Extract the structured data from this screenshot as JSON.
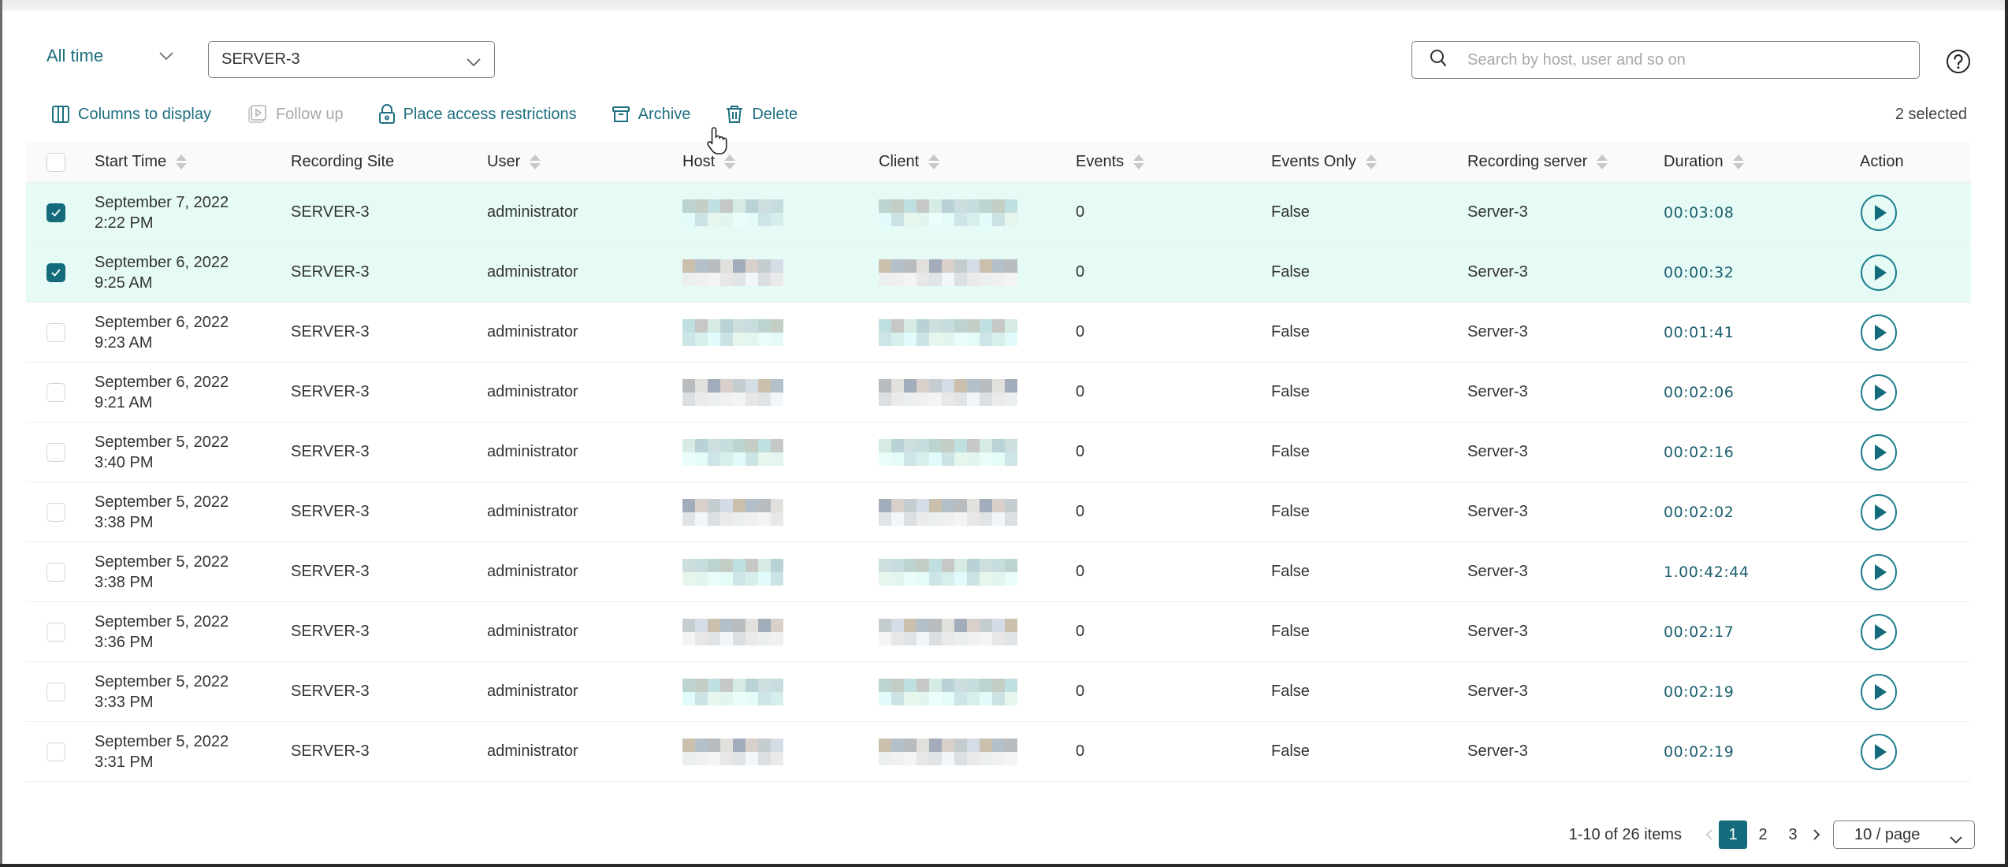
{
  "filters": {
    "time_range": "All time",
    "site": "SERVER-3",
    "search_placeholder": "Search by host, user and so on",
    "search_value": ""
  },
  "toolbar": {
    "columns_label": "Columns to display",
    "follow_up_label": "Follow up",
    "restrict_label": "Place access restrictions",
    "archive_label": "Archive",
    "delete_label": "Delete",
    "selected_count": "2 selected"
  },
  "table": {
    "headers": {
      "start_time": "Start Time",
      "recording_site": "Recording Site",
      "user": "User",
      "host": "Host",
      "client": "Client",
      "events": "Events",
      "events_only": "Events Only",
      "recording_server": "Recording server",
      "duration": "Duration",
      "action": "Action"
    },
    "rows": [
      {
        "selected": true,
        "date": "September 7, 2022",
        "time": "2:22 PM",
        "site": "SERVER-3",
        "user": "administrator",
        "host": "[redacted]",
        "client": "[redacted]",
        "events": "0",
        "events_only": "False",
        "server": "Server-3",
        "duration": "00:03:08"
      },
      {
        "selected": true,
        "date": "September 6, 2022",
        "time": "9:25 AM",
        "site": "SERVER-3",
        "user": "administrator",
        "host": "[redacted]",
        "client": "[redacted]",
        "events": "0",
        "events_only": "False",
        "server": "Server-3",
        "duration": "00:00:32"
      },
      {
        "selected": false,
        "date": "September 6, 2022",
        "time": "9:23 AM",
        "site": "SERVER-3",
        "user": "administrator",
        "host": "[redacted]",
        "client": "[redacted]",
        "events": "0",
        "events_only": "False",
        "server": "Server-3",
        "duration": "00:01:41"
      },
      {
        "selected": false,
        "date": "September 6, 2022",
        "time": "9:21 AM",
        "site": "SERVER-3",
        "user": "administrator",
        "host": "[redacted]",
        "client": "[redacted]",
        "events": "0",
        "events_only": "False",
        "server": "Server-3",
        "duration": "00:02:06"
      },
      {
        "selected": false,
        "date": "September 5, 2022",
        "time": "3:40 PM",
        "site": "SERVER-3",
        "user": "administrator",
        "host": "[redacted]",
        "client": "[redacted]",
        "events": "0",
        "events_only": "False",
        "server": "Server-3",
        "duration": "00:02:16"
      },
      {
        "selected": false,
        "date": "September 5, 2022",
        "time": "3:38 PM",
        "site": "SERVER-3",
        "user": "administrator",
        "host": "[redacted]",
        "client": "[redacted]",
        "events": "0",
        "events_only": "False",
        "server": "Server-3",
        "duration": "00:02:02"
      },
      {
        "selected": false,
        "date": "September 5, 2022",
        "time": "3:38 PM",
        "site": "SERVER-3",
        "user": "administrator",
        "host": "[redacted]",
        "client": "[redacted]",
        "events": "0",
        "events_only": "False",
        "server": "Server-3",
        "duration": "1.00:42:44"
      },
      {
        "selected": false,
        "date": "September 5, 2022",
        "time": "3:36 PM",
        "site": "SERVER-3",
        "user": "administrator",
        "host": "[redacted]",
        "client": "[redacted]",
        "events": "0",
        "events_only": "False",
        "server": "Server-3",
        "duration": "00:02:17"
      },
      {
        "selected": false,
        "date": "September 5, 2022",
        "time": "3:33 PM",
        "site": "SERVER-3",
        "user": "administrator",
        "host": "[redacted]",
        "client": "[redacted]",
        "events": "0",
        "events_only": "False",
        "server": "Server-3",
        "duration": "00:02:19"
      },
      {
        "selected": false,
        "date": "September 5, 2022",
        "time": "3:31 PM",
        "site": "SERVER-3",
        "user": "administrator",
        "host": "[redacted]",
        "client": "[redacted]",
        "events": "0",
        "events_only": "False",
        "server": "Server-3",
        "duration": "00:02:19"
      }
    ]
  },
  "pagination": {
    "range_text": "1-10 of 26 items",
    "pages": [
      "1",
      "2",
      "3"
    ],
    "current_page": "1",
    "page_size": "10 / page"
  },
  "colors": {
    "accent": "#136b7c",
    "link": "#1d6f80",
    "selected_row_bg": "#e6fbf6"
  },
  "icons": {
    "time_dropdown": "chevron-down-icon",
    "search": "search-icon",
    "help": "help-circle-icon",
    "columns": "columns-icon",
    "follow_up": "follow-up-icon",
    "restrict": "lock-icon",
    "archive": "archive-icon",
    "delete": "trash-icon",
    "play": "play-circle-icon"
  }
}
